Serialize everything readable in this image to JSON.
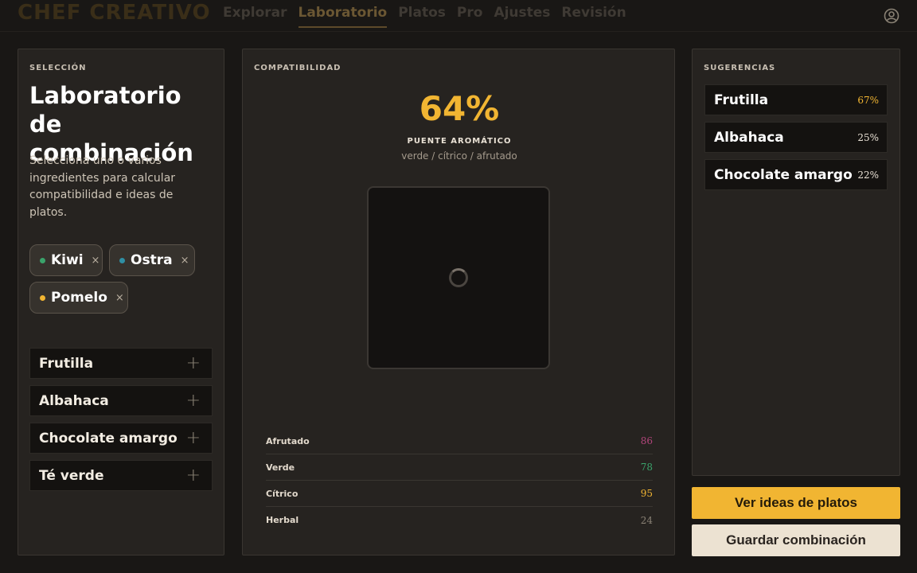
{
  "app": {
    "brand": "CHEF CREATIVO",
    "nav": [
      "Explorar",
      "Laboratorio",
      "Platos",
      "Pro",
      "Ajustes",
      "Revisión"
    ],
    "active_nav": "Laboratorio"
  },
  "selection": {
    "section_label": "SELECCIÓN",
    "title": "Laboratorio de combinación",
    "description": "Selecciona uno o varios ingredientes para calcular compatibilidad e ideas de platos.",
    "chips": [
      {
        "name": "Kiwi",
        "color": "#3aa36b",
        "remove": "×"
      },
      {
        "name": "Ostra",
        "color": "#2f8fa4",
        "remove": "×"
      },
      {
        "name": "Pomelo",
        "color": "#f1b532",
        "remove": "×"
      }
    ],
    "add_options": [
      {
        "name": "Frutilla",
        "icon": "+"
      },
      {
        "name": "Albahaca",
        "icon": "+"
      },
      {
        "name": "Chocolate amargo",
        "icon": "+"
      },
      {
        "name": "Té verde",
        "icon": "+"
      }
    ]
  },
  "compatibility": {
    "section_label": "COMPATIBILIDAD",
    "percent": "64%",
    "bridge_title": "PUENTE AROMÁTICO",
    "bridge_sub": "verde / cítrico / afrutado",
    "metrics": [
      {
        "label": "Afrutado",
        "value": "86",
        "color": "#b0457a"
      },
      {
        "label": "Verde",
        "value": "78",
        "color": "#3aa36b"
      },
      {
        "label": "Cítrico",
        "value": "95",
        "color": "#f1b532"
      },
      {
        "label": "Herbal",
        "value": "24",
        "color": "#8a8275"
      }
    ]
  },
  "suggestions": {
    "section_label": "SUGERENCIAS",
    "items": [
      {
        "name": "Frutilla",
        "score": "67%",
        "color": "#f1b532"
      },
      {
        "name": "Albahaca",
        "score": "25%",
        "color": "#e9e1d5"
      },
      {
        "name": "Chocolate amargo",
        "score": "22%",
        "color": "#e9e1d5"
      }
    ]
  },
  "actions": {
    "primary": "Ver ideas de platos",
    "secondary": "Guardar combinación"
  }
}
